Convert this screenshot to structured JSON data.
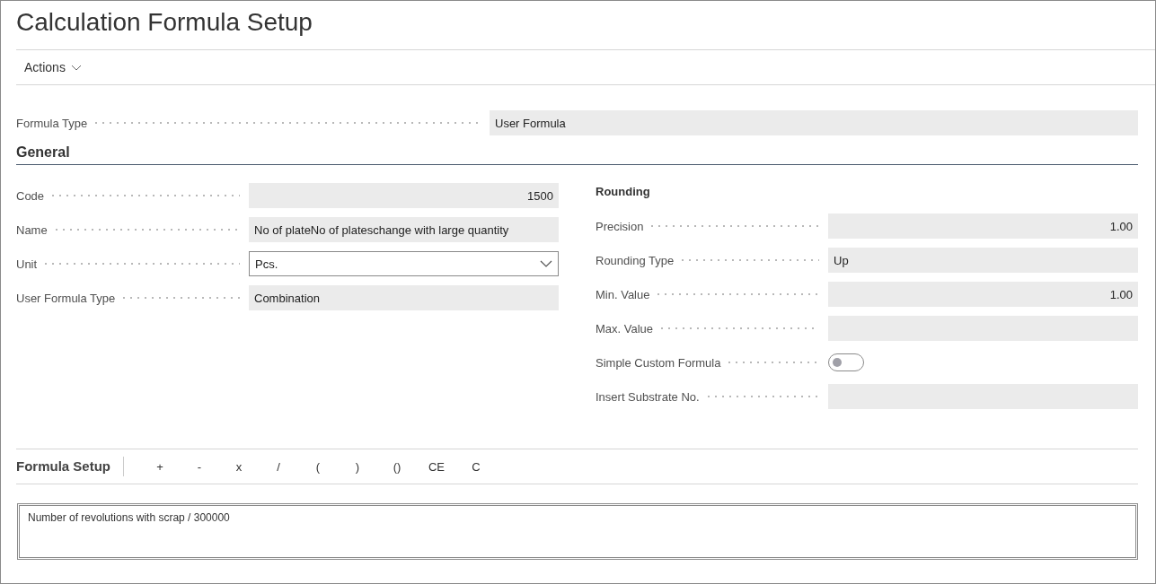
{
  "page": {
    "title": "Calculation Formula Setup"
  },
  "action_bar": {
    "items": [
      {
        "label": "Actions",
        "kind": "menu"
      }
    ]
  },
  "formula_type": {
    "label": "Formula Type",
    "value": "User Formula"
  },
  "general": {
    "title": "General",
    "left_fields": [
      {
        "label": "Code",
        "kind": "number",
        "value": "1500"
      },
      {
        "label": "Name",
        "kind": "text",
        "value": "No of plateNo of plateschange with large quantity"
      },
      {
        "label": "Unit",
        "kind": "dropdown",
        "value": "Pcs."
      },
      {
        "label": "User Formula Type",
        "kind": "text",
        "value": "Combination"
      }
    ],
    "right_group": {
      "title": "Rounding",
      "fields": [
        {
          "label": "Precision",
          "kind": "number",
          "value": "1.00"
        },
        {
          "label": "Rounding Type",
          "kind": "text",
          "value": "Up"
        },
        {
          "label": "Min. Value",
          "kind": "number",
          "value": "1.00"
        },
        {
          "label": "Max. Value",
          "kind": "number"
        },
        {
          "label": "Simple Custom Formula",
          "kind": "toggle",
          "on": false
        },
        {
          "label": "Insert Substrate No.",
          "kind": "text"
        }
      ]
    }
  },
  "formula_setup": {
    "title": "Formula Setup",
    "buttons": [
      "+",
      "-",
      "x",
      "/",
      "(",
      ")",
      "()",
      "CE",
      "C"
    ],
    "formula": "Number of revolutions with scrap / 300000"
  }
}
